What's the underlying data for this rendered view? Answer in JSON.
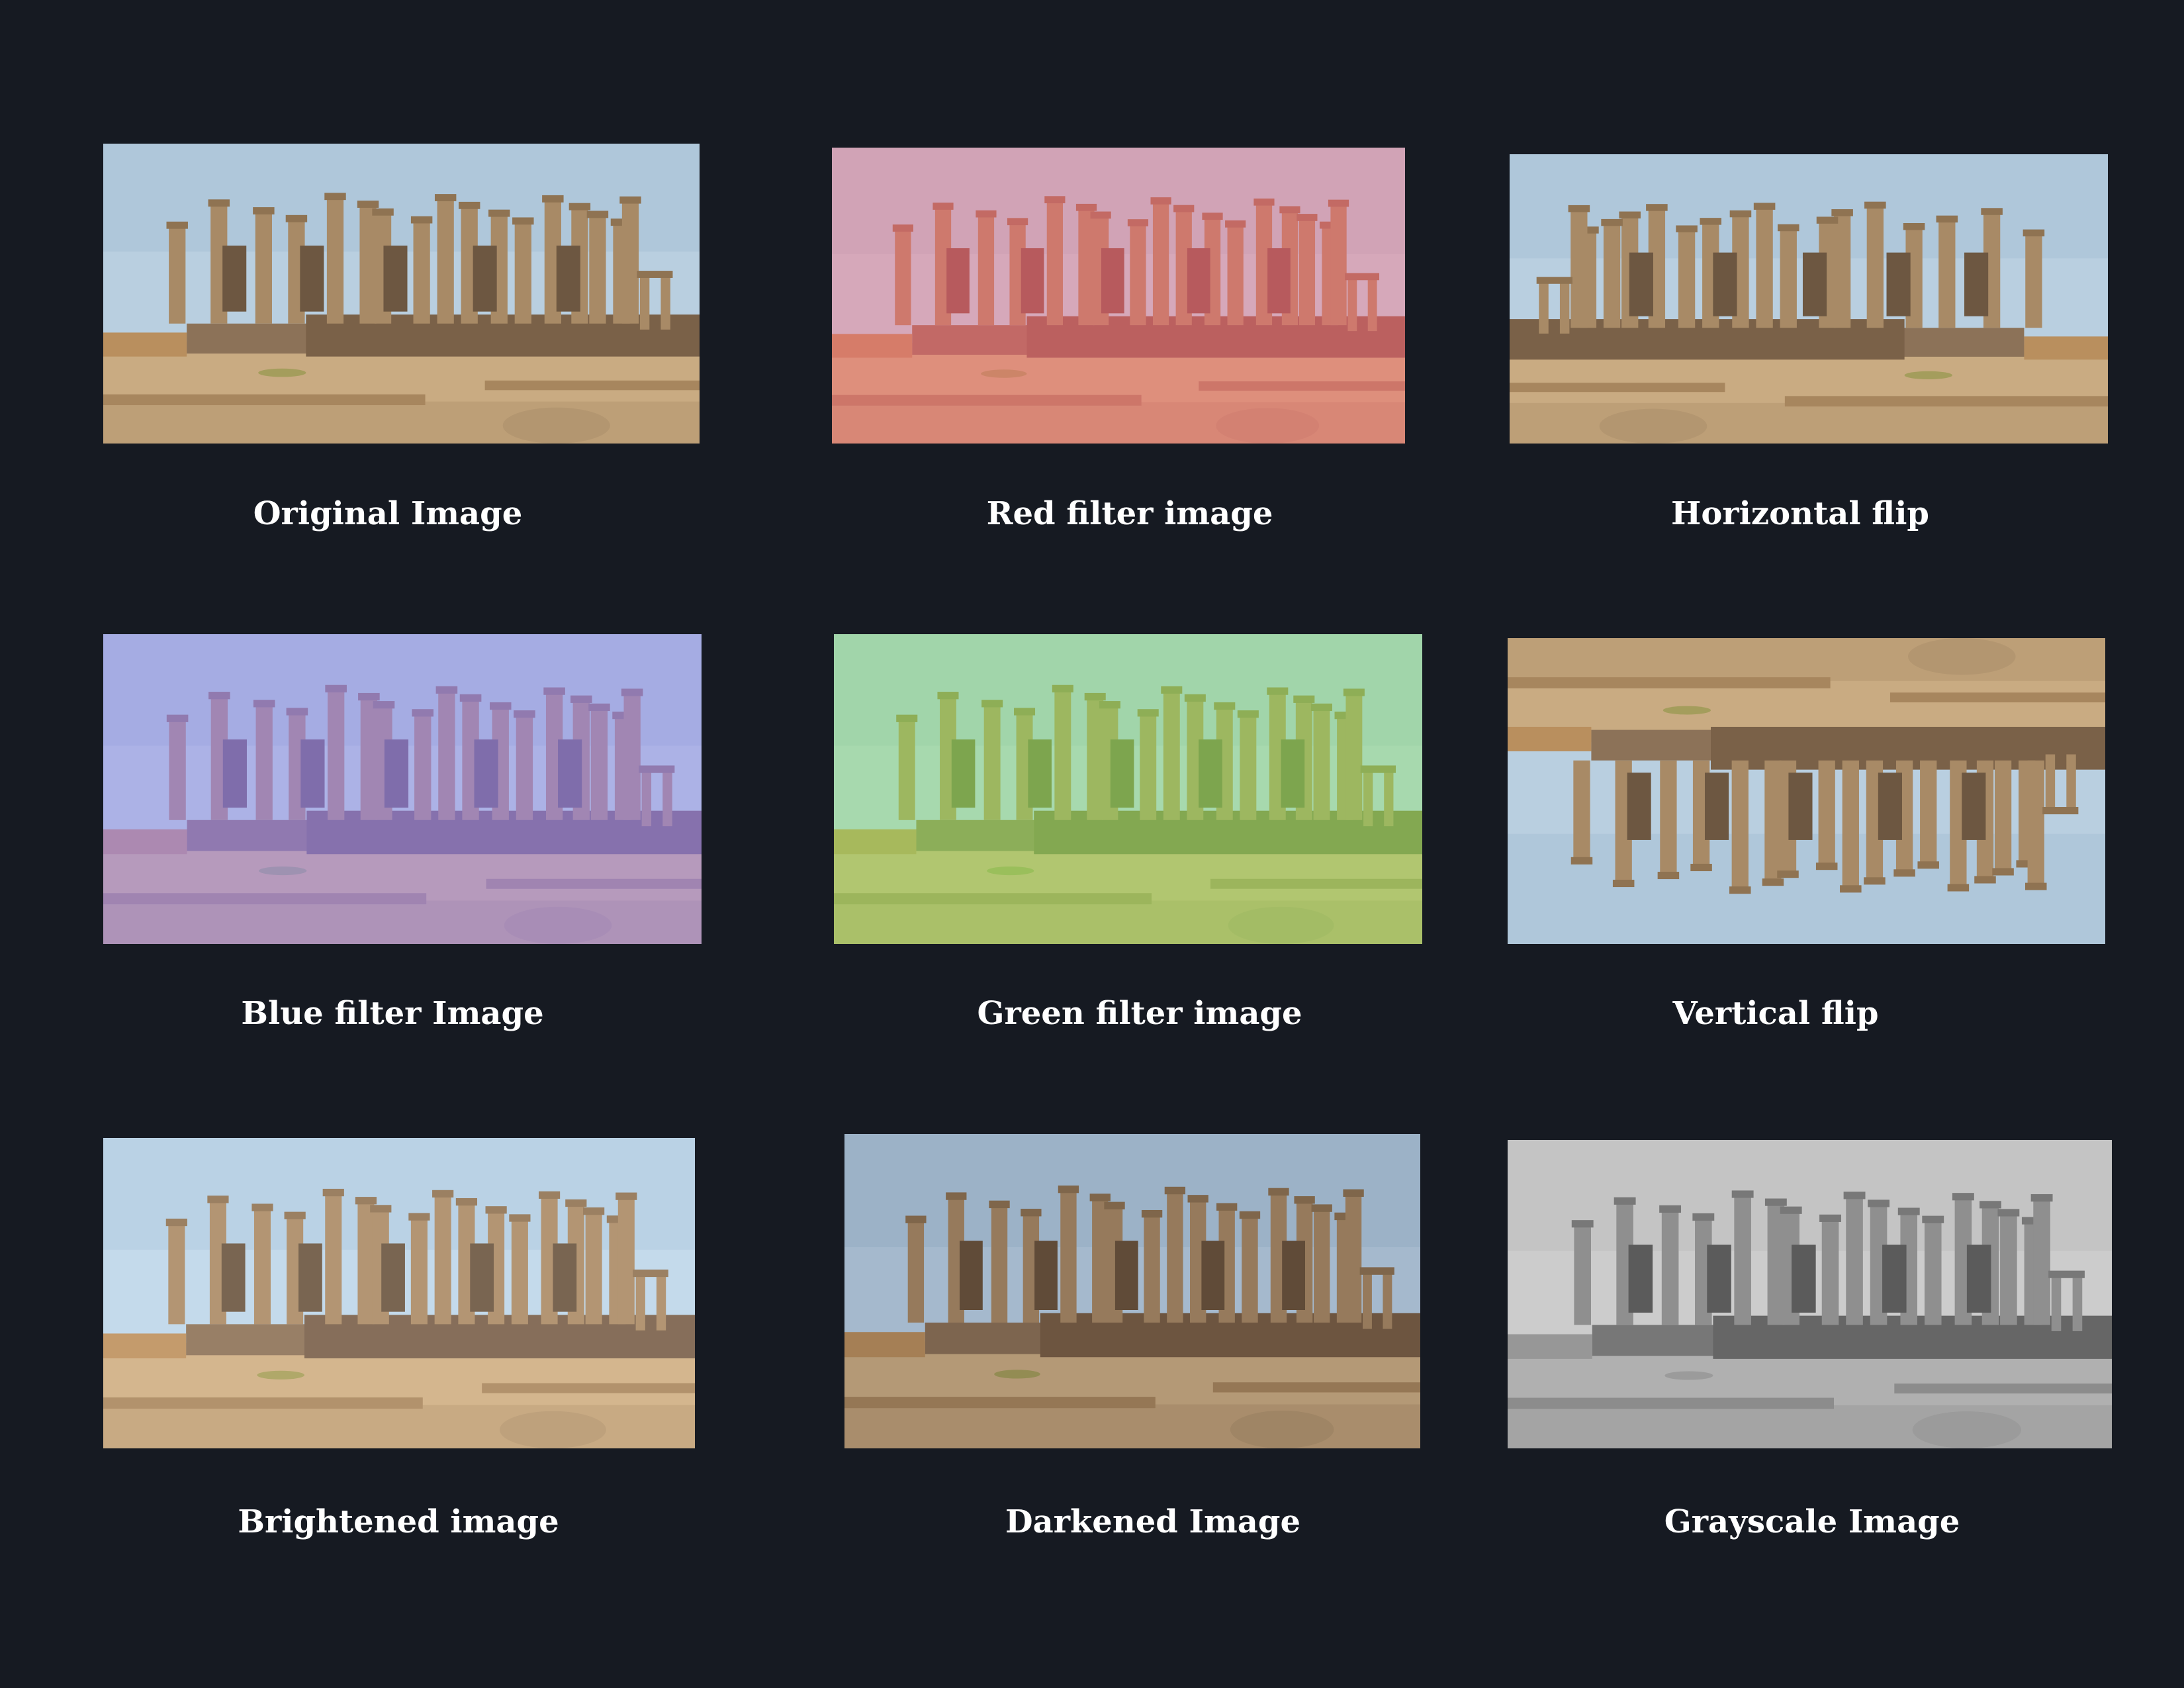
{
  "panels": [
    {
      "caption": "Original Image",
      "effect": "original"
    },
    {
      "caption": "Red filter image",
      "effect": "red filter"
    },
    {
      "caption": "Horizontal flip",
      "effect": "horizontal flip"
    },
    {
      "caption": "Blue filter Image",
      "effect": "blue filter"
    },
    {
      "caption": "Green filter image",
      "effect": "green filter"
    },
    {
      "caption": "Vertical flip",
      "effect": "vertical flip"
    },
    {
      "caption": "Brightened image",
      "effect": "brightened"
    },
    {
      "caption": "Darkened Image",
      "effect": "darkened"
    },
    {
      "caption": "Grayscale Image",
      "effect": "grayscale"
    }
  ],
  "colors": {
    "background": "#161a22",
    "caption": "#ffffff",
    "sky": "#b9cfe0",
    "stone": "#a88a66",
    "ground": "#c9ab82"
  }
}
